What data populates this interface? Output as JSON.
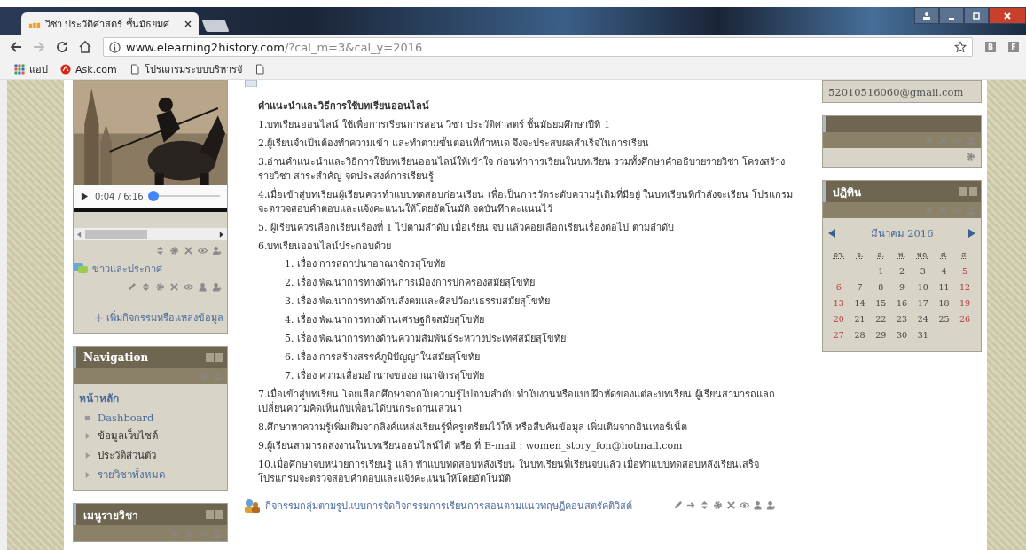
{
  "browser": {
    "tab_title": "วิชา ประวัติศาสตร์ ชั้นมัธยมศ",
    "url_host": "www.elearning2history.com",
    "url_path": "/?cal_m=3&cal_y=2016",
    "bookmarks": [
      {
        "kind": "apps",
        "label": "แอป"
      },
      {
        "kind": "ask",
        "label": "Ask.com"
      },
      {
        "kind": "page",
        "label": "โปรแกรมระบบบริหารจั"
      }
    ],
    "extensions": [
      "B",
      "F"
    ]
  },
  "left": {
    "player": {
      "time": "0:04 / 6:16",
      "level": 0.06
    },
    "news_link": "ข่าวและประกาศ",
    "add_activity": "เพิ่มกิจกรรมหรือแหล่งข้อมูล",
    "navigation": {
      "title": "Navigation",
      "home": "หน้าหลัก",
      "items": [
        {
          "label": "Dashboard",
          "kind": "leaf",
          "link": true
        },
        {
          "label": "ข้อมูลเว็บไซต์",
          "kind": "branch",
          "link": false
        },
        {
          "label": "ประวัติส่วนตัว",
          "kind": "branch",
          "link": false
        },
        {
          "label": "รายวิชาทั้งหมด",
          "kind": "branch",
          "link": true
        }
      ]
    },
    "course_menu": {
      "title": "เมนูรายวิชา"
    }
  },
  "main": {
    "heading": "คำแนะนำและวิธีการใช้บทเรียนออนไลน์",
    "items": [
      {
        "text": "1.บทเรียนออนไลน์ ใช้เพื่อการเรียนการสอน วิชา ประวัติศาสตร์ ชั้นมัธยมศึกษาปีที่ 1"
      },
      {
        "text": "2.ผู้เรียนจำเป็นต้องทำความเข้า และทำตามขั้นตอนที่กำหนด จึงจะประสบผลสำเร็จในการเรียน"
      },
      {
        "text": "3.อ่านคำแนะนำและวิธีการใช้บทเรียนออนไลน์ให้เข้าใจ ก่อนทำการเรียนในบทเรียน รวมทั้งศึกษาคำอธิบายรายวิชา โครงสร้างรายวิชา สาระสำคัญ จุดประสงค์การเรียนรู้"
      },
      {
        "text": "4.เมื่อเข้าสู่บทเรียนผู้เรียนควรทำแบบทดสอบก่อนเรียน เพื่อเป็นการวัดระดับความรู้เดิมที่มีอยู่ ในบทเรียนที่กำลังจะเรียน โปรแกรมจะตรวจสอบคำตอบและแจ้งคะแนนให้โดยอัตโนมัติ จดบันทึกคะแนนไว้"
      },
      {
        "text": "5. ผู้เรียนควรเลือกเรียนเรื่องที่ 1 ไปตามลำดับ เมื่อเรียน จบ แล้วค่อยเลือกเรียนเรื่องต่อไป ตามลำดับ"
      },
      {
        "text": "6.บทเรียนออนไลน์ประกอบด้วย",
        "children": [
          "1. เรื่อง การสถาปนาอาณาจักรสุโขทัย",
          "2. เรื่อง พัฒนาการทางด้านการเมืองการปกครองสมัยสุโขทัย",
          "3. เรื่อง พัฒนาการทางด้านสังคมและศิลปวัฒนธรรมสมัยสุโขทัย",
          "4. เรื่อง พัฒนาการทางด้านเศรษฐกิจสมัยสุโขทัย",
          "5. เรื่อง พัฒนาการทางด้านความสัมพันธ์ระหว่างประเทศสมัยสุโขทัย",
          "6. เรื่อง การสร้างสรรค์ภูมิปัญญาในสมัยสุโขทัย",
          "7. เรื่อง ความเสื่อมอำนาจของอาณาจักรสุโขทัย"
        ]
      },
      {
        "text": "7.เมื่อเข้าสู่บทเรียน โดยเลือกศึกษาจากใบความรู้ไปตามลำดับ ทำใบงานหรือแบบฝึกหัดของแต่ละบทเรียน ผู้เรียนสามารถแลกเปลี่ยนความคิดเห็นกับเพื่อนได้บนกระดานเสวนา"
      },
      {
        "text": "8.ศึกษาหาความรู้เพิ่มเติมจากลิงค์แหล่งเรียนรู้ที่ครูเตรียมไว้ให้ หรือสืบค้นข้อมูล เพิ่มเติมจากอินเทอร์เน็ต"
      },
      {
        "text": "9.ผู้เรียนสามารถส่งงานในบทเรียนออนไลน์ได้ หรือ ที่ E-mail : women_story_fon@hotmail.com"
      },
      {
        "text": "10.เมื่อศึกษาจบหน่วยการเรียนรู้ แล้ว ทำแบบทดสอบหลังเรียน ในบทเรียนที่เรียนจบแล้ว เมื่อทำแบบทดสอบหลังเรียนเสร็จ โปรแกรมจะตรวจสอบคำตอบและแจ้งคะแนนให้โดยอัตโนมัติ"
      }
    ],
    "activity_link": "กิจกรรมกลุ่มตามรูปแบบการจัดกิจกรรมการเรียนการสอนตามแนวทฤษฎีคอนสตรัคติวิสต์"
  },
  "right": {
    "email": "52010516060@gmail.com",
    "calendar": {
      "title": "ปฏิทิน",
      "month": "มีนาคม 2016",
      "weekdays": [
        "อา.",
        "จ.",
        "อ.",
        "พ.",
        "พฤ.",
        "ศ.",
        "ส."
      ],
      "weeks": [
        {
          "days": [
            {
              "day": "1",
              "weekend": false
            },
            {
              "day": "2",
              "weekend": false
            },
            {
              "day": "3",
              "weekend": false
            },
            {
              "day": "4",
              "weekend": false
            },
            {
              "day": "5",
              "weekend": true
            }
          ]
        },
        {
          "days": [
            {
              "day": "6",
              "weekend": true
            },
            {
              "day": "7",
              "weekend": false
            },
            {
              "day": "8",
              "weekend": false
            },
            {
              "day": "9",
              "weekend": false
            },
            {
              "day": "10",
              "weekend": false
            },
            {
              "day": "11",
              "weekend": false
            },
            {
              "day": "12",
              "weekend": true
            }
          ]
        },
        {
          "days": [
            {
              "day": "13",
              "weekend": true
            },
            {
              "day": "14",
              "weekend": false
            },
            {
              "day": "15",
              "weekend": false
            },
            {
              "day": "16",
              "weekend": false
            },
            {
              "day": "17",
              "weekend": false
            },
            {
              "day": "18",
              "weekend": false
            },
            {
              "day": "19",
              "weekend": true
            }
          ]
        },
        {
          "days": [
            {
              "day": "20",
              "weekend": true
            },
            {
              "day": "21",
              "weekend": false
            },
            {
              "day": "22",
              "weekend": false
            },
            {
              "day": "23",
              "weekend": false
            },
            {
              "day": "24",
              "weekend": false
            },
            {
              "day": "25",
              "weekend": false
            },
            {
              "day": "26",
              "weekend": true
            }
          ]
        },
        {
          "days": [
            {
              "day": "27",
              "weekend": true
            },
            {
              "day": "28",
              "weekend": false
            },
            {
              "day": "29",
              "weekend": false
            },
            {
              "day": "30",
              "weekend": false
            },
            {
              "day": "31",
              "weekend": false
            }
          ]
        }
      ]
    }
  }
}
